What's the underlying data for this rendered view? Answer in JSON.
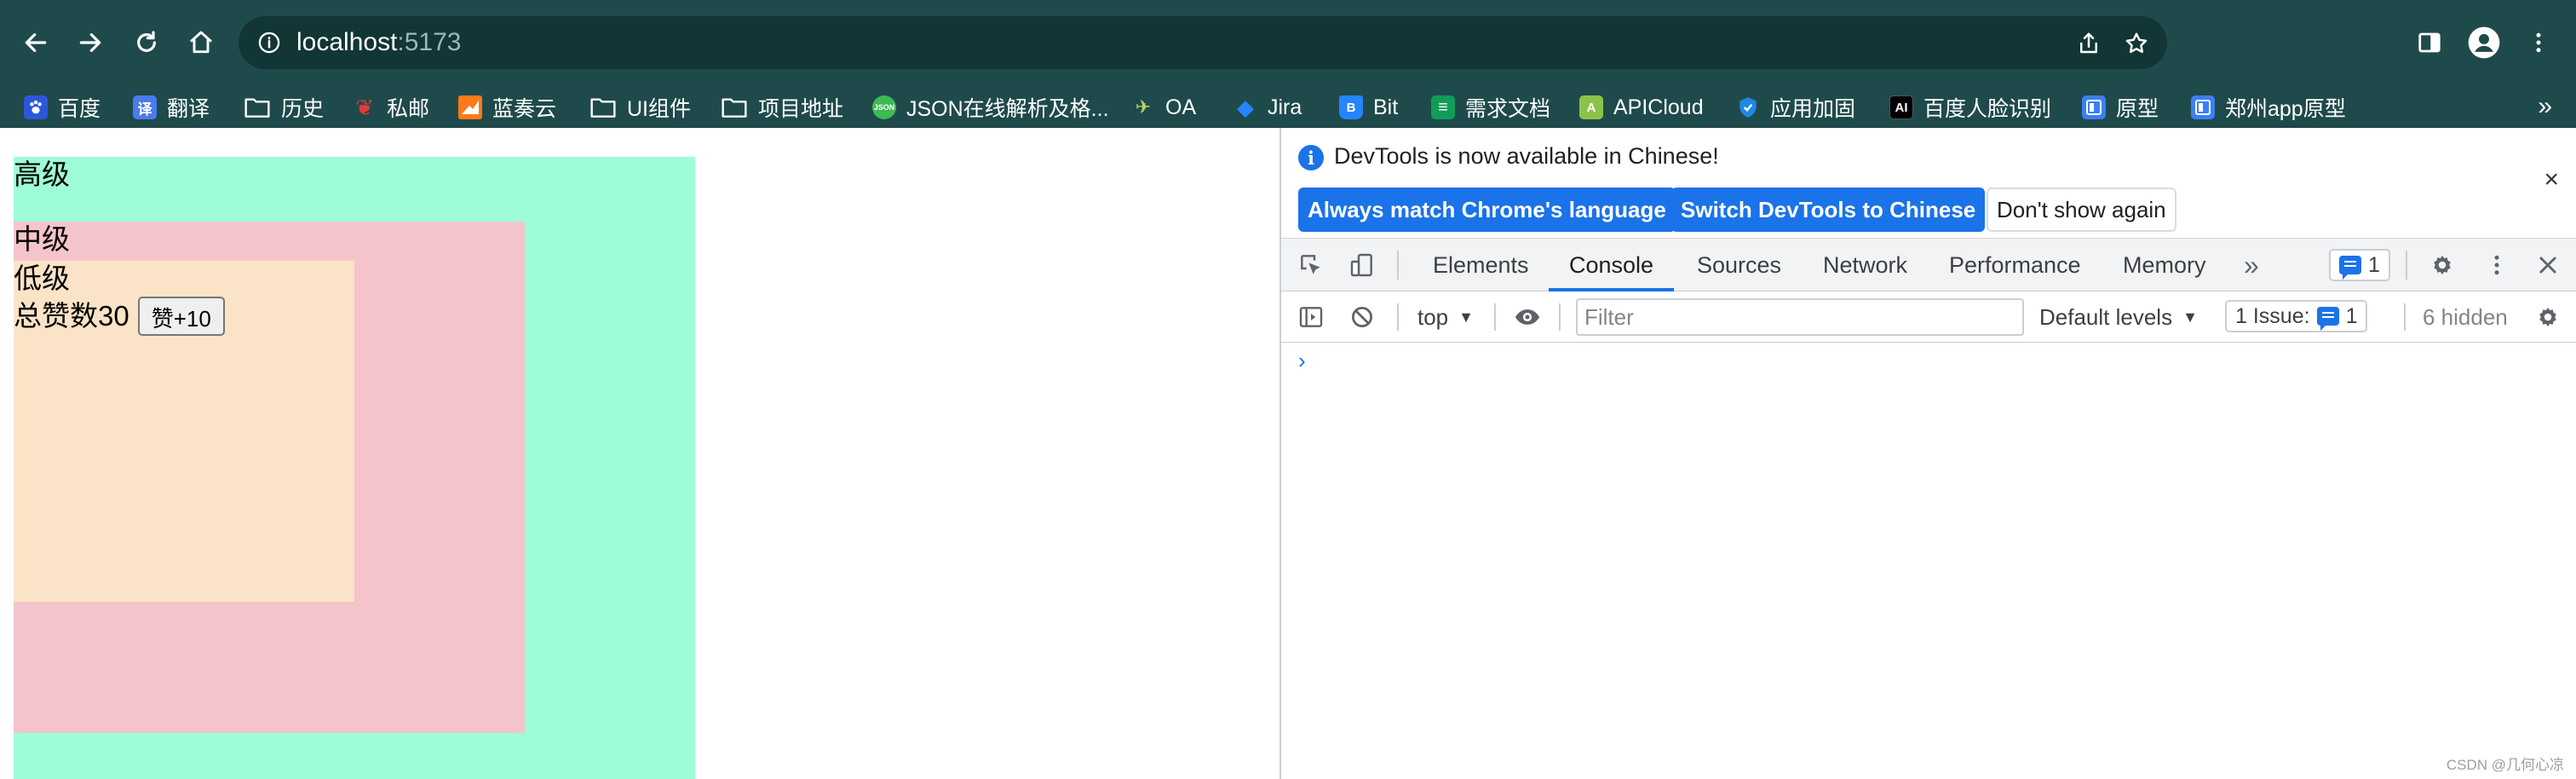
{
  "browser": {
    "url_host": "localhost",
    "url_port": ":5173"
  },
  "bookmarks": {
    "items": [
      {
        "label": "百度",
        "icon": "baidu-paw-icon",
        "color": "#2b58d9",
        "glyph": "🐾"
      },
      {
        "label": "翻译",
        "icon": "translate-icon",
        "color": "#4b7bec",
        "glyph": "译"
      },
      {
        "label": "历史",
        "icon": "folder-icon",
        "color": "",
        "glyph": ""
      },
      {
        "label": "私邮",
        "icon": "mail-icon",
        "color": "#e53935",
        "glyph": "邮"
      },
      {
        "label": "蓝奏云",
        "icon": "cloud-icon",
        "color": "#ff7a1a",
        "glyph": "◢"
      },
      {
        "label": "UI组件",
        "icon": "folder-icon",
        "color": "",
        "glyph": ""
      },
      {
        "label": "项目地址",
        "icon": "folder-icon",
        "color": "",
        "glyph": ""
      },
      {
        "label": "JSON在线解析及格...",
        "icon": "json-icon",
        "color": "#3cba54",
        "glyph": "J"
      },
      {
        "label": "OA",
        "icon": "oa-icon",
        "color": "",
        "glyph": "✈"
      },
      {
        "label": "Jira",
        "icon": "jira-icon",
        "color": "#2684ff",
        "glyph": "◆"
      },
      {
        "label": "Bit",
        "icon": "bitbucket-icon",
        "color": "#2684ff",
        "glyph": "B"
      },
      {
        "label": "需求文档",
        "icon": "sheet-icon",
        "color": "#0f9d58",
        "glyph": "≡"
      },
      {
        "label": "APICloud",
        "icon": "apicloud-icon",
        "color": "#8bc34a",
        "glyph": "A"
      },
      {
        "label": "应用加固",
        "icon": "shield-icon",
        "color": "#1e88e5",
        "glyph": "盾"
      },
      {
        "label": "百度人脸识别",
        "icon": "ai-icon",
        "color": "#000000",
        "glyph": "AI"
      },
      {
        "label": "原型",
        "icon": "prototype-icon",
        "color": "#3b7ff5",
        "glyph": "▣"
      },
      {
        "label": "郑州app原型",
        "icon": "prototype-icon",
        "color": "#3b7ff5",
        "glyph": "▣"
      }
    ],
    "more": "»"
  },
  "page": {
    "high_title": "高级",
    "mid_title": "中级",
    "low_title": "低级",
    "like_text": "总赞数30",
    "like_button": "赞+10",
    "colors": {
      "high": "#9efdd6",
      "mid": "#f5c4cb",
      "low": "#fbe3c7"
    }
  },
  "devtools": {
    "info_message": "DevTools is now available in Chinese!",
    "btn_match": "Always match Chrome's language",
    "btn_switch": "Switch DevTools to Chinese",
    "btn_dismiss": "Don't show again",
    "close": "×",
    "tabs": [
      "Elements",
      "Console",
      "Sources",
      "Network",
      "Performance",
      "Memory"
    ],
    "more_tabs": "»",
    "issue_count": "1",
    "context": "top",
    "filter_placeholder": "Filter",
    "levels": "Default levels",
    "issues_label": "1 Issue:",
    "issues_count": "1",
    "hidden": "6 hidden",
    "prompt": "›"
  },
  "watermark": "CSDN @几何心凉"
}
